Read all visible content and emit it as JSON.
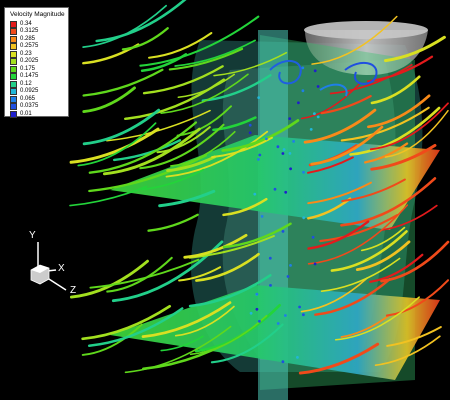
{
  "legend": {
    "title": "Velocity Magnitude",
    "items": [
      {
        "label": "0.34",
        "color": "#e31a1c"
      },
      {
        "label": "0.3125",
        "color": "#f04a1a"
      },
      {
        "label": "0.285",
        "color": "#f98a19"
      },
      {
        "label": "0.2575",
        "color": "#f2c221"
      },
      {
        "label": "0.23",
        "color": "#d9e022"
      },
      {
        "label": "0.2025",
        "color": "#a3e01f"
      },
      {
        "label": "0.175",
        "color": "#5fd81c"
      },
      {
        "label": "0.1475",
        "color": "#23d43a"
      },
      {
        "label": "0.12",
        "color": "#22cf8a"
      },
      {
        "label": "0.0925",
        "color": "#21b7d8"
      },
      {
        "label": "0.065",
        "color": "#1f7fe8"
      },
      {
        "label": "0.0375",
        "color": "#1f4fe0"
      },
      {
        "label": "0.01",
        "color": "#1f1fcc"
      }
    ]
  },
  "axes": {
    "y_label": "Y",
    "x_label": "X",
    "z_label": "Z"
  }
}
